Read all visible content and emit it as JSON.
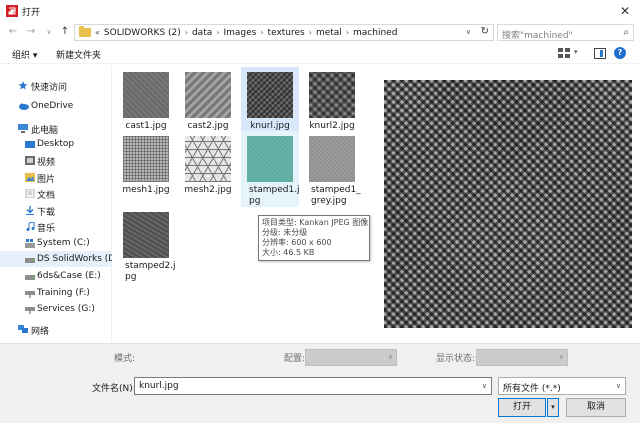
{
  "window": {
    "title": "打开",
    "close_glyph": "✕"
  },
  "nav": {
    "back_glyph": "←",
    "forward_glyph": "→",
    "recent_glyph": "∨",
    "up_glyph": "↑",
    "overflow_glyph": "«",
    "breadcrumbs": [
      "SOLIDWORKS (2)",
      "data",
      "Images",
      "textures",
      "metal",
      "machined"
    ],
    "crumb_sep": "›",
    "dropdown_glyph": "∨",
    "refresh_glyph": "↻",
    "search_placeholder": "搜索\"machined\"",
    "search_glyph": "⌕"
  },
  "toolbar": {
    "organize_label": "组织 ▾",
    "new_folder_label": "新建文件夹",
    "view_dd_glyph": "▾",
    "help_glyph": "?"
  },
  "sidebar": {
    "items": [
      {
        "label": "快速访问"
      },
      {
        "label": "OneDrive"
      },
      {
        "label": "此电脑"
      },
      {
        "label": "Desktop"
      },
      {
        "label": "视频"
      },
      {
        "label": "图片"
      },
      {
        "label": "文档"
      },
      {
        "label": "下载"
      },
      {
        "label": "音乐"
      },
      {
        "label": "System (C:)"
      },
      {
        "label": "DS SolidWorks (D:"
      },
      {
        "label": "6ds&Case (E:)"
      },
      {
        "label": "Training (F:)"
      },
      {
        "label": "Services (G:)"
      },
      {
        "label": "网络"
      }
    ]
  },
  "files": [
    {
      "name": "cast1.jpg"
    },
    {
      "name": "cast2.jpg"
    },
    {
      "name": "knurl.jpg"
    },
    {
      "name": "knurl2.jpg"
    },
    {
      "name": "mesh1.jpg"
    },
    {
      "name": "mesh2.jpg"
    },
    {
      "name": "stamped1.j pg"
    },
    {
      "name": "stamped1_ grey.jpg"
    },
    {
      "name": "stamped2.j pg"
    }
  ],
  "tooltip": {
    "lines": [
      "项目类型: Kankan JPEG 图像",
      "分级: 未分级",
      "分辨率: 600 x 600",
      "大小: 46.5 KB"
    ]
  },
  "footer": {
    "mode_label": "模式:",
    "config_label": "配置:",
    "display_state_label": "显示状态:",
    "filename_label": "文件名(N):",
    "filename_value": "knurl.jpg",
    "filetype_value": "所有文件 (*.*)",
    "dropdown_glyph": "∨",
    "open_label": "打开",
    "open_split_glyph": "▾",
    "cancel_label": "取消"
  }
}
